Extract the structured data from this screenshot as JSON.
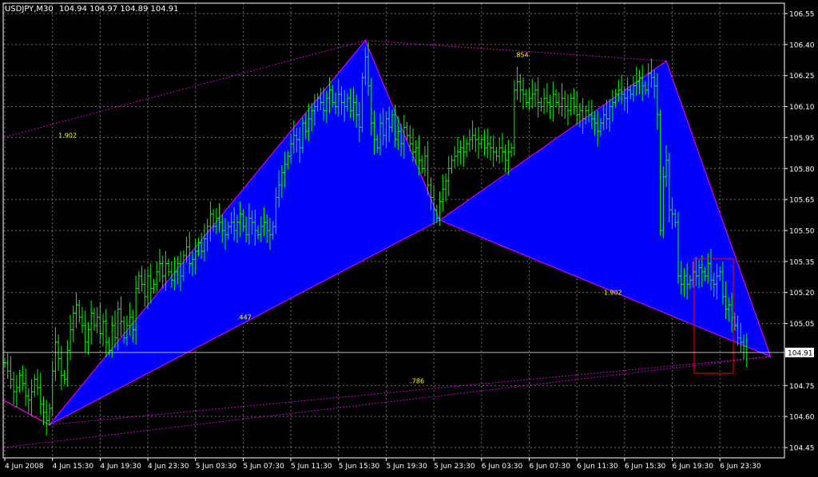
{
  "header": {
    "symbol_tf": "USDJPY,M30",
    "ohlc": "104.94 104.97 104.89 104.91"
  },
  "colors": {
    "background": "#000000",
    "grid": "#c8c8c8",
    "candle": "#00ff00",
    "pattern_fill": "#0000ff",
    "pattern_edge": "#ff00ff",
    "ratio_label": "#ffff00",
    "price_line": "#c0c0c0",
    "box": "#ff0000",
    "axis_text": "#ffffff"
  },
  "chart_data": {
    "type": "candlestick",
    "symbol": "USDJPY",
    "timeframe": "M30",
    "last_price": "104.91",
    "y_ticks": [
      "106.55",
      "106.40",
      "106.25",
      "106.10",
      "105.95",
      "105.80",
      "105.65",
      "105.50",
      "105.35",
      "105.20",
      "105.05",
      "104.75",
      "104.60",
      "104.45"
    ],
    "ylim": [
      104.4,
      106.6
    ],
    "x_ticks": [
      "4 Jun 2008",
      "4 Jun 15:30",
      "4 Jun 19:30",
      "4 Jun 23:30",
      "5 Jun 03:30",
      "5 Jun 07:30",
      "5 Jun 11:30",
      "5 Jun 15:30",
      "5 Jun 19:30",
      "5 Jun 23:30",
      "6 Jun 03:30",
      "6 Jun 07:30",
      "6 Jun 11:30",
      "6 Jun 15:30",
      "6 Jun 19:30",
      "6 Jun 23:30"
    ],
    "pattern_points": {
      "X": {
        "bar": 0,
        "price": 104.7
      },
      "A": {
        "bar": 15,
        "price": 104.56
      },
      "B": {
        "bar": 121,
        "price": 106.42
      },
      "C": {
        "bar": 146,
        "price": 105.55
      },
      "D": {
        "bar": 222,
        "price": 106.32
      },
      "E": {
        "bar": 257,
        "price": 104.89
      }
    },
    "ratio_labels": [
      {
        "text": "1.902",
        "bar": 18,
        "price": 105.95
      },
      {
        "text": ".447",
        "bar": 78,
        "price": 105.07
      },
      {
        "text": ".786",
        "bar": 136,
        "price": 104.76
      },
      {
        "text": ".854",
        "bar": 171,
        "price": 106.34
      },
      {
        "text": "1.902",
        "bar": 201,
        "price": 105.19
      }
    ],
    "closes": [
      104.86,
      104.82,
      104.78,
      104.72,
      104.74,
      104.8,
      104.76,
      104.7,
      104.68,
      104.72,
      104.78,
      104.74,
      104.66,
      104.62,
      104.58,
      104.64,
      104.82,
      104.96,
      104.88,
      104.8,
      104.78,
      104.92,
      105.02,
      105.1,
      105.14,
      105.08,
      105.04,
      104.96,
      105.02,
      105.1,
      105.04,
      105.08,
      105.0,
      105.06,
      104.96,
      104.92,
      105.04,
      104.98,
      105.12,
      105.06,
      104.98,
      105.04,
      105.08,
      105.02,
      105.22,
      105.28,
      105.24,
      105.18,
      105.28,
      105.22,
      105.24,
      105.3,
      105.34,
      105.28,
      105.34,
      105.3,
      105.26,
      105.3,
      105.34,
      105.28,
      105.38,
      105.42,
      105.34,
      105.36,
      105.4,
      105.44,
      105.4,
      105.46,
      105.52,
      105.58,
      105.52,
      105.56,
      105.54,
      105.5,
      105.48,
      105.52,
      105.54,
      105.5,
      105.54,
      105.58,
      105.52,
      105.48,
      105.56,
      105.54,
      105.5,
      105.48,
      105.52,
      105.54,
      105.5,
      105.48,
      105.52,
      105.66,
      105.72,
      105.78,
      105.82,
      105.86,
      105.92,
      105.96,
      105.94,
      105.9,
      106.02,
      105.98,
      106.04,
      106.08,
      106.1,
      106.14,
      106.12,
      106.08,
      106.14,
      106.18,
      106.12,
      106.1,
      106.16,
      106.12,
      106.1,
      106.14,
      106.08,
      106.12,
      106.06,
      106.0,
      106.24,
      106.34,
      106.2,
      106.02,
      105.94,
      105.9,
      106.02,
      105.96,
      106.04,
      106.0,
      106.06,
      105.94,
      105.98,
      105.92,
      106.0,
      105.96,
      105.92,
      105.88,
      105.9,
      105.84,
      105.8,
      105.86,
      105.72,
      105.66,
      105.6,
      105.56,
      105.64,
      105.7,
      105.74,
      105.8,
      105.84,
      105.86,
      105.88,
      105.9,
      105.88,
      105.92,
      105.94,
      105.96,
      105.94,
      105.92,
      105.94,
      105.9,
      105.92,
      105.9,
      105.88,
      105.86,
      105.9,
      105.88,
      105.84,
      105.88,
      105.9,
      106.18,
      106.22,
      106.18,
      106.16,
      106.12,
      106.14,
      106.16,
      106.18,
      106.12,
      106.1,
      106.14,
      106.12,
      106.1,
      106.16,
      106.12,
      106.1,
      106.14,
      106.1,
      106.08,
      106.14,
      106.1,
      106.06,
      106.08,
      106.04,
      106.08,
      106.06,
      106.04,
      106.02,
      105.98,
      106.02,
      106.06,
      106.04,
      106.1,
      106.12,
      106.16,
      106.18,
      106.16,
      106.14,
      106.18,
      106.16,
      106.2,
      106.22,
      106.24,
      106.2,
      106.18,
      106.26,
      106.24,
      106.2,
      106.06,
      105.5,
      105.76,
      105.84,
      105.6,
      105.58,
      105.54,
      105.28,
      105.24,
      105.28,
      105.24,
      105.26,
      105.3,
      105.28,
      105.32,
      105.3,
      105.28,
      105.34,
      105.26,
      105.24,
      105.28,
      105.3,
      105.18,
      105.12,
      105.14,
      105.08,
      105.04,
      104.98,
      104.96,
      104.94,
      104.91
    ]
  }
}
